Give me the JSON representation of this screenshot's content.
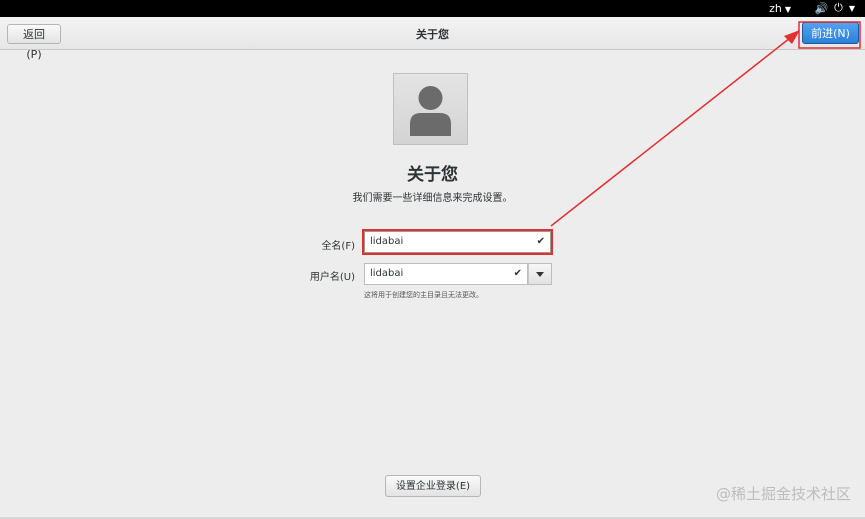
{
  "topbar": {
    "language": "zh",
    "icons": [
      "volume-icon",
      "power-icon"
    ]
  },
  "header": {
    "back_label": "返回(P)",
    "title": "关于您",
    "next_label": "前进(N)"
  },
  "main": {
    "heading": "关于您",
    "subheading": "我们需要一些详细信息来完成设置。",
    "fullname_label": "全名(F)",
    "fullname_value": "lidabai",
    "username_label": "用户名(U)",
    "username_value": "lidabai",
    "hint": "这将用于创建您的主目录且无法更改。",
    "enterprise_button": "设置企业登录(E)"
  },
  "watermark": "@稀土掘金技术社区",
  "colors": {
    "accent": "#3584e4",
    "annotation": "#e03030",
    "background": "#ededed"
  }
}
